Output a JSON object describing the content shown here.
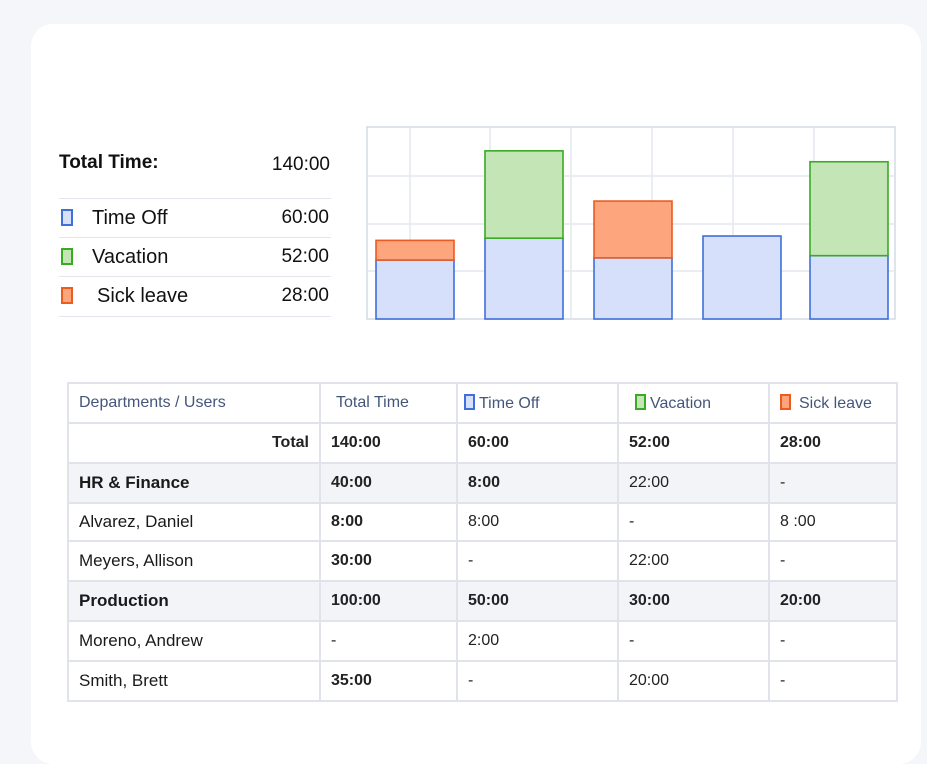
{
  "summary": {
    "title": "Total Time:",
    "total": "140:00",
    "items": [
      {
        "label": "Time Off",
        "value": "60:00",
        "icon": "time-off-swatch-icon",
        "fill": "#d6e0fb",
        "border": "#3f6fd8"
      },
      {
        "label": "Vacation",
        "value": "52:00",
        "icon": "vacation-swatch-icon",
        "fill": "#c4e6b6",
        "border": "#3aaa25"
      },
      {
        "label": "Sick leave",
        "value": "28:00",
        "icon": "sick-leave-swatch-icon",
        "fill": "#fda67e",
        "border": "#ec5b1f"
      }
    ]
  },
  "chart_data": {
    "type": "bar",
    "stacked": true,
    "categories": [
      "",
      "",
      "",
      "",
      ""
    ],
    "series": [
      {
        "name": "Time Off",
        "values": [
          2.7,
          3.7,
          2.8,
          3.8,
          2.9
        ],
        "color": "#d6e0fb",
        "border": "#3f6fd8"
      },
      {
        "name": "Vacation",
        "values": [
          0,
          4.0,
          0,
          0,
          4.3
        ],
        "color": "#c4e6b6",
        "border": "#3aaa25"
      },
      {
        "name": "Sick leave",
        "values": [
          0.9,
          0,
          2.6,
          0,
          0
        ],
        "color": "#fda67e",
        "border": "#ec5b1f"
      }
    ],
    "ylim": [
      0,
      8.7
    ],
    "grid": true
  },
  "table": {
    "headers": {
      "col0": "Departments / Users",
      "col1": "Total Time",
      "col2": "Time Off",
      "col3": "Vacation",
      "col4": "Sick leave"
    },
    "total_row": {
      "label": "Total",
      "total": "140:00",
      "time_off": "60:00",
      "vacation": "52:00",
      "sick": "28:00"
    },
    "rows": [
      {
        "name": "HR & Finance",
        "total": "40:00",
        "time_off": "8:00",
        "vacation": "22:00",
        "sick": "-"
      },
      {
        "name": "Alvarez, Daniel",
        "total": "8:00",
        "time_off": "8:00",
        "vacation": "-",
        "sick": "8 :00"
      },
      {
        "name": "Meyers, Allison",
        "total": "30:00",
        "time_off": "-",
        "vacation": "22:00",
        "sick": "-"
      },
      {
        "name": "Production",
        "total": "100:00",
        "time_off": "50:00",
        "vacation": "30:00",
        "sick": "20:00"
      },
      {
        "name": "Moreno, Andrew",
        "total": "-",
        "time_off": "2:00",
        "vacation": "-",
        "sick": "-"
      },
      {
        "name": "Smith, Brett",
        "total": "35:00",
        "time_off": "-",
        "vacation": "20:00",
        "sick": "-"
      }
    ]
  }
}
